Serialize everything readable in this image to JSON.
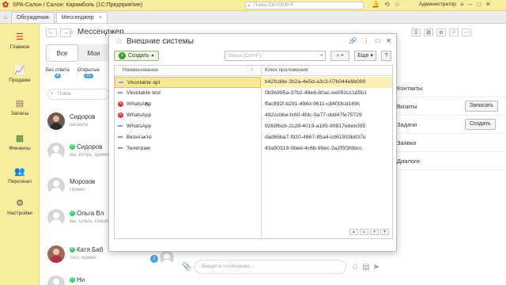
{
  "window": {
    "title": "SPA-Салон / Салон: Карамболь (1С:Предприятие)",
    "search_placeholder": "Поиск Ctrl+Shift+F",
    "user": "Администратор"
  },
  "tabs": [
    {
      "label": "Обсуждения"
    },
    {
      "label": "Мессенджер"
    }
  ],
  "sidebar": {
    "items": [
      {
        "label": "Главное"
      },
      {
        "label": "Продажи"
      },
      {
        "label": "Запасы"
      },
      {
        "label": "Финансы"
      },
      {
        "label": "Персонал"
      },
      {
        "label": "Настройки"
      }
    ]
  },
  "messenger": {
    "title": "Мессенджер",
    "filters": [
      "Все",
      "Мои"
    ],
    "status_tabs": [
      {
        "label": "Без ответа",
        "count": "4"
      },
      {
        "label": "Открытые",
        "count": "21"
      }
    ],
    "search_placeholder": "Поиск",
    "chats": [
      {
        "name": "Сидоров",
        "preview": "цвсаолн"
      },
      {
        "name": "Сидоров",
        "preview": "Вы: Игорь, привет"
      },
      {
        "name": "Морозов",
        "preview": "Привет"
      },
      {
        "name": "Ольга Вл",
        "preview": "Вы: Ольга, спасибо"
      },
      {
        "name": "Катя Баб",
        "preview": "Тест, привет"
      },
      {
        "name": "Ни",
        "preview": ""
      }
    ],
    "unread": "1",
    "message_placeholder": "Введите сообщение..."
  },
  "right_panel": {
    "rows": [
      {
        "label": "Контакты",
        "button": ""
      },
      {
        "label": "Визиты",
        "button": "Записать"
      },
      {
        "label": "Задачи",
        "button": "Создать"
      },
      {
        "label": "Заявки",
        "button": ""
      },
      {
        "label": "Диалоги",
        "button": ""
      }
    ]
  },
  "modal": {
    "title": "Внешние системы",
    "create_label": "Создать",
    "search_placeholder": "Поиск (Ctrl+F)",
    "find_label": "",
    "more_label": "Еще",
    "help_label": "?",
    "columns": [
      "Наименование",
      "Ключ приложения"
    ],
    "rows": [
      {
        "name": "Vkontakte api",
        "key": "b42fcd8e-2b2a-4e5d-a3c3-07b044e6b090",
        "marker": "dash",
        "selected": true
      },
      {
        "name": "Vkontakte test",
        "key": "0b3b995a-37b2-48e6-80ac-ee092cc1d5b1",
        "marker": "dash",
        "selected": false
      },
      {
        "name": "WhatsApp",
        "key": "ffac892f-b291-494d-9611-c84f33cd169c",
        "marker": "delete",
        "selected": false
      },
      {
        "name": "WhatsApp",
        "key": "492ccbbe-fc60-4fdc-9a77-ddd47fe75729",
        "marker": "delete",
        "selected": false
      },
      {
        "name": "WhatsApp",
        "key": "9268fbcb-2c28-4019-a185-90817e8eb395",
        "marker": "dash",
        "selected": false
      },
      {
        "name": "Вконтакте",
        "key": "dad65ba7-f920-4867-85a4-cd61933b837e",
        "marker": "dash",
        "selected": false
      },
      {
        "name": "Телеграм",
        "key": "43a50319-0bed-4c6b-99ec-2a2f5f3fdbcc",
        "marker": "dash",
        "selected": false
      }
    ]
  },
  "colors": {
    "accent": "#fbed9e",
    "selection": "#fdf1b7",
    "create_green": "#3a9a2a",
    "badge_blue": "#4aa3df",
    "whatsapp_green": "#25d366"
  }
}
